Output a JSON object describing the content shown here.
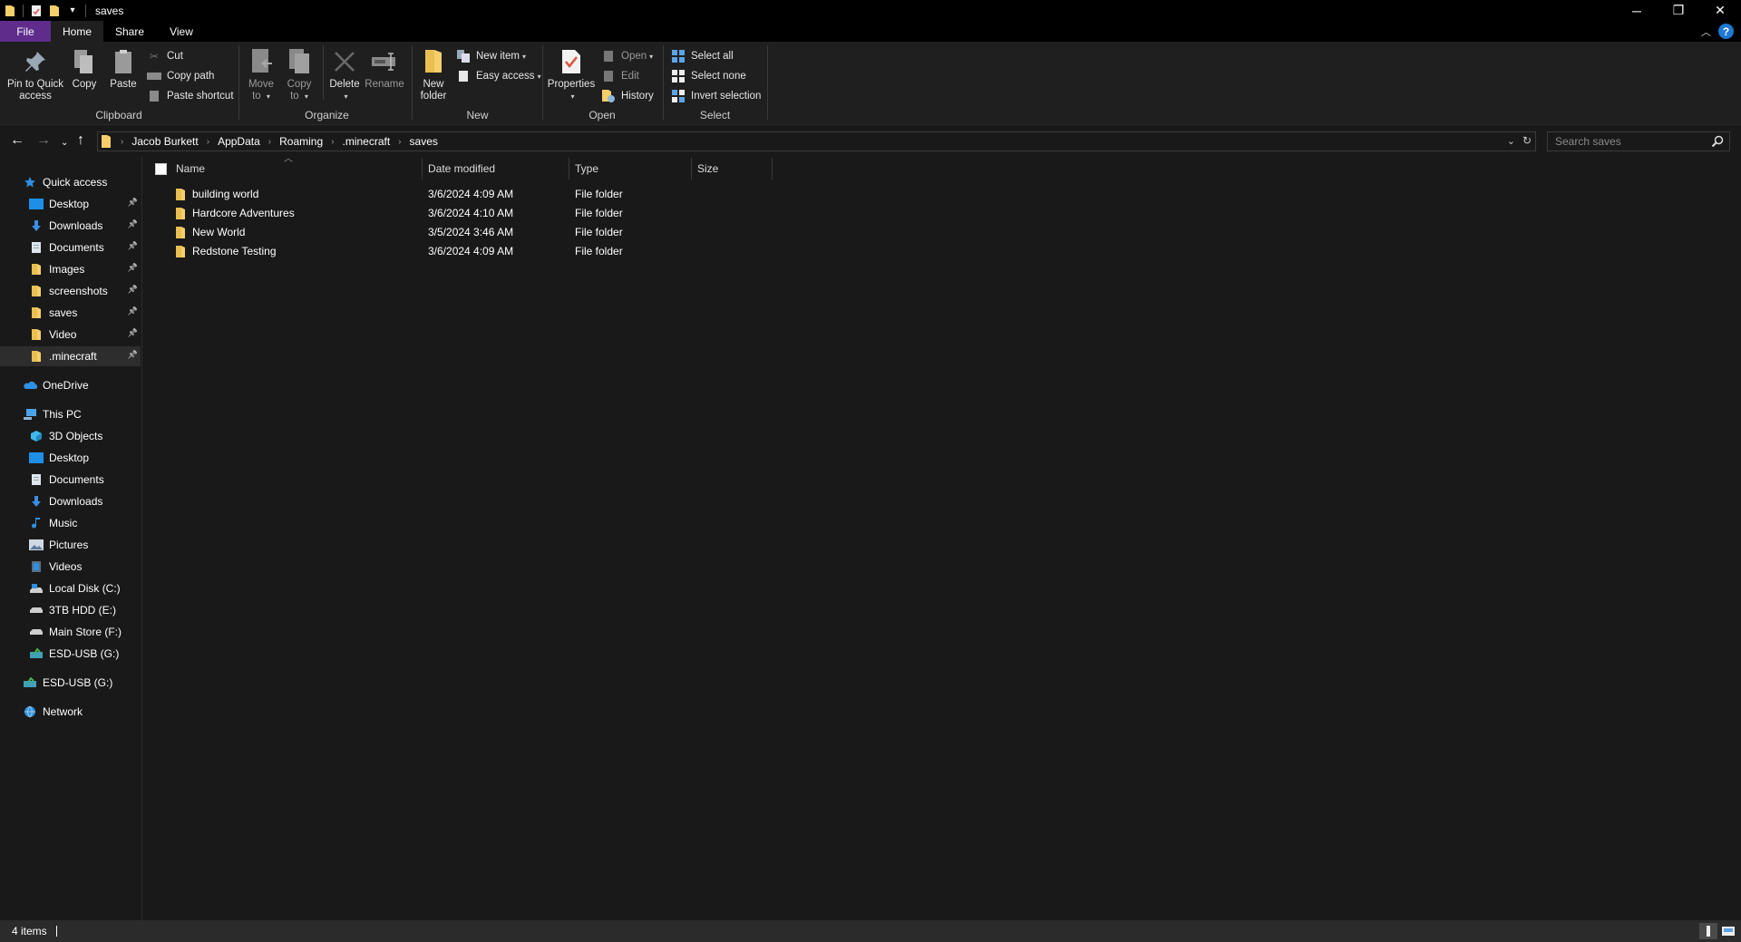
{
  "window": {
    "title": "saves",
    "controls": {
      "minimize": "─",
      "restore": "❐",
      "close": "✕"
    }
  },
  "ribbon_tabs": [
    {
      "label": "File"
    },
    {
      "label": "Home"
    },
    {
      "label": "Share"
    },
    {
      "label": "View"
    }
  ],
  "ribbon": {
    "clipboard": {
      "label": "Clipboard",
      "pin": "Pin to Quick",
      "pin_line2": "access",
      "copy": "Copy",
      "paste": "Paste",
      "cut": "Cut",
      "copy_path": "Copy path",
      "paste_shortcut": "Paste shortcut"
    },
    "organize": {
      "label": "Organize",
      "move": "Move",
      "move_line2": "to",
      "copy": "Copy",
      "copy_line2": "to",
      "delete": "Delete",
      "rename": "Rename"
    },
    "new": {
      "label": "New",
      "new_folder": "New",
      "new_folder_line2": "folder",
      "new_item": "New item",
      "easy_access": "Easy access"
    },
    "open": {
      "label": "Open",
      "properties": "Properties",
      "open": "Open",
      "edit": "Edit",
      "history": "History"
    },
    "select": {
      "label": "Select",
      "select_all": "Select all",
      "select_none": "Select none",
      "invert_selection": "Invert selection"
    }
  },
  "address": {
    "breadcrumbs": [
      "Jacob Burkett",
      "AppData",
      "Roaming",
      ".minecraft",
      "saves"
    ],
    "search_placeholder": "Search saves"
  },
  "sidebar": {
    "quick_access": {
      "label": "Quick access",
      "items": [
        {
          "label": "Desktop",
          "icon": "desktop"
        },
        {
          "label": "Downloads",
          "icon": "downloads"
        },
        {
          "label": "Documents",
          "icon": "documents"
        },
        {
          "label": "Images",
          "icon": "folder"
        },
        {
          "label": "screenshots",
          "icon": "folder"
        },
        {
          "label": "saves",
          "icon": "folder"
        },
        {
          "label": "Video",
          "icon": "folder"
        },
        {
          "label": ".minecraft",
          "icon": "folder",
          "selected": true
        }
      ]
    },
    "onedrive": {
      "label": "OneDrive"
    },
    "this_pc": {
      "label": "This PC",
      "items": [
        {
          "label": "3D Objects"
        },
        {
          "label": "Desktop"
        },
        {
          "label": "Documents"
        },
        {
          "label": "Downloads"
        },
        {
          "label": "Music"
        },
        {
          "label": "Pictures"
        },
        {
          "label": "Videos"
        },
        {
          "label": "Local Disk (C:)"
        },
        {
          "label": "3TB HDD (E:)"
        },
        {
          "label": "Main Store (F:)"
        },
        {
          "label": "ESD-USB (G:)"
        }
      ]
    },
    "usb": {
      "label": "ESD-USB (G:)"
    },
    "network": {
      "label": "Network"
    }
  },
  "file_list": {
    "columns": [
      "Name",
      "Date modified",
      "Type",
      "Size"
    ],
    "rows": [
      {
        "name": "building world",
        "date": "3/6/2024 4:09 AM",
        "type": "File folder",
        "size": ""
      },
      {
        "name": "Hardcore Adventures",
        "date": "3/6/2024 4:10 AM",
        "type": "File folder",
        "size": ""
      },
      {
        "name": "New World",
        "date": "3/5/2024 3:46 AM",
        "type": "File folder",
        "size": ""
      },
      {
        "name": "Redstone Testing",
        "date": "3/6/2024 4:09 AM",
        "type": "File folder",
        "size": ""
      }
    ]
  },
  "status": {
    "item_count": "4 items"
  },
  "colors": {
    "file_tab": "#5f2c8c",
    "folder": "#f5cf6a",
    "accent_blue": "#1f78d1"
  }
}
